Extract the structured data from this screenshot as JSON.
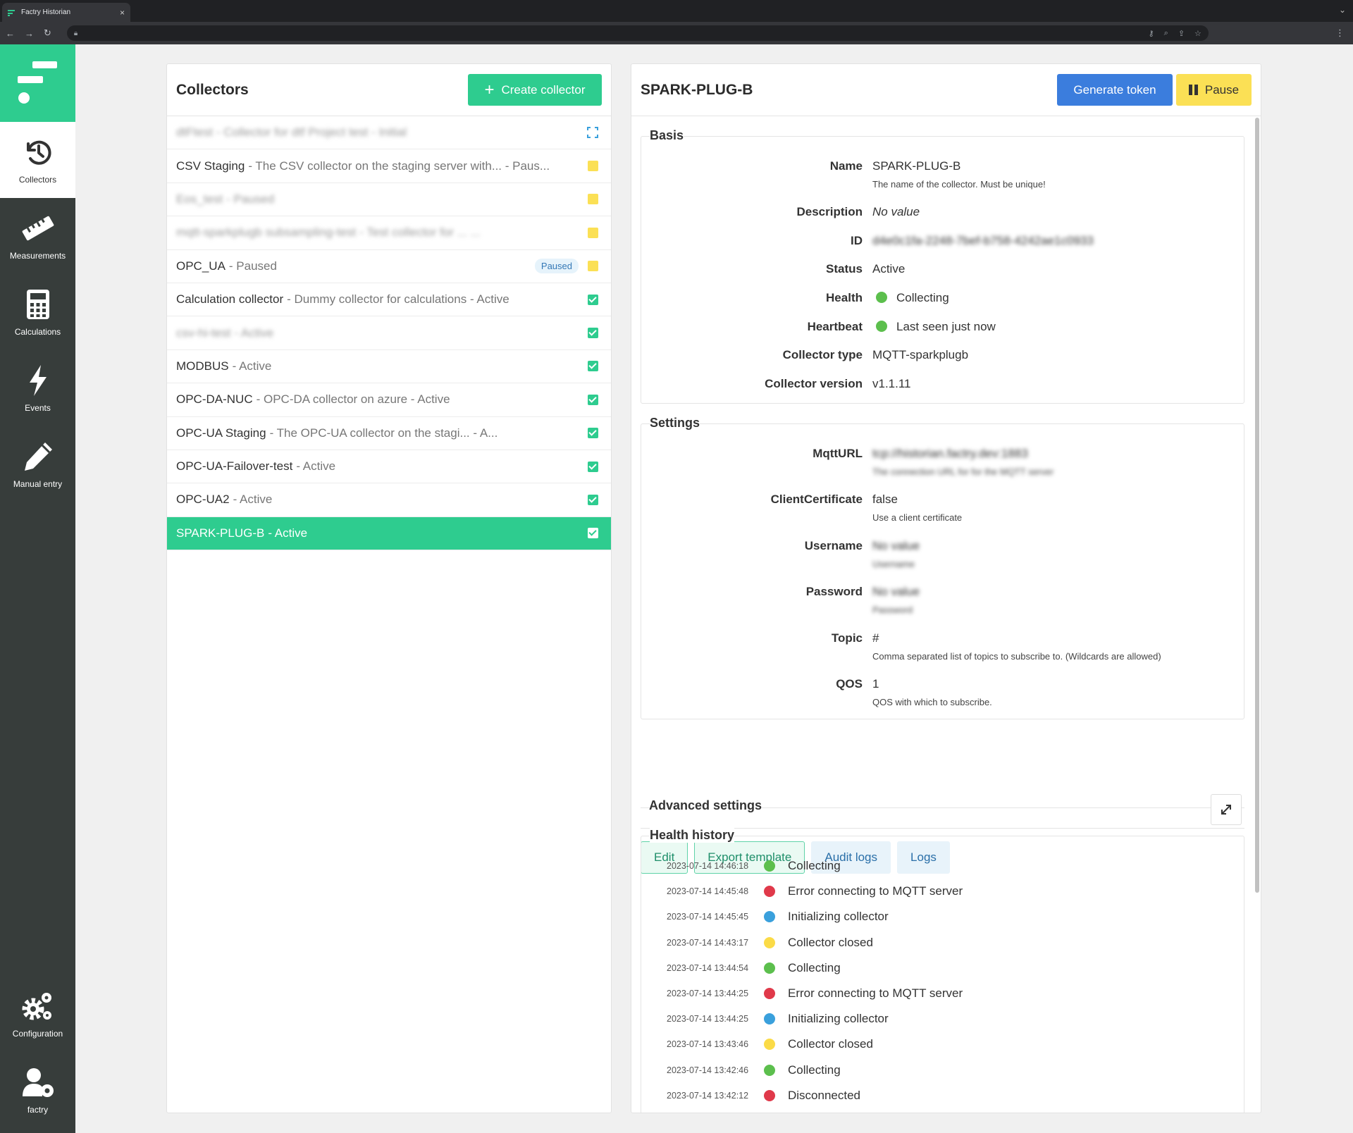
{
  "browser": {
    "tab_title": "Factry Historian",
    "tab_close": "×"
  },
  "sidebar": {
    "items": [
      {
        "label": "Collectors",
        "icon": "history-icon"
      },
      {
        "label": "Measurements",
        "icon": "ruler-icon"
      },
      {
        "label": "Calculations",
        "icon": "calculator-icon"
      },
      {
        "label": "Events",
        "icon": "bolt-icon"
      },
      {
        "label": "Manual entry",
        "icon": "pencil-icon"
      },
      {
        "label": "Configuration",
        "icon": "gears-icon"
      },
      {
        "label": "factry",
        "icon": "user-gear-icon"
      }
    ]
  },
  "collectors": {
    "title": "Collectors",
    "create_label": "Create collector",
    "items": [
      {
        "name": "dtFtest",
        "desc": "- Collector for dtf Project test - Initial",
        "blurred": true,
        "marker": "expand"
      },
      {
        "name": "CSV Staging",
        "desc": "- The CSV collector on the staging server with... - Paus...",
        "blurred": false,
        "marker": "yellow"
      },
      {
        "name": "Eos_test",
        "desc": "- Paused",
        "blurred": true,
        "marker": "yellow"
      },
      {
        "name": "mqtt-sparkplugb subsampling-test",
        "desc": "- Test collector for ... ...",
        "blurred": true,
        "marker": "yellow"
      },
      {
        "name": "OPC_UA",
        "desc": " - Paused",
        "blurred": false,
        "marker": "yellow",
        "badge": "Paused"
      },
      {
        "name": "Calculation collector",
        "desc": "- Dummy collector for calculations - Active",
        "blurred": false,
        "marker": "green"
      },
      {
        "name": "csv-hi-test",
        "desc": "- Active",
        "blurred": true,
        "marker": "green"
      },
      {
        "name": "MODBUS",
        "desc": " - Active",
        "blurred": false,
        "marker": "green"
      },
      {
        "name": "OPC-DA-NUC",
        "desc": "- OPC-DA collector on azure - Active",
        "blurred": false,
        "marker": "green"
      },
      {
        "name": "OPC-UA Staging",
        "desc": "- The OPC-UA collector on the stagi... - A...",
        "blurred": false,
        "marker": "green"
      },
      {
        "name": "OPC-UA-Failover-test",
        "desc": " - Active",
        "blurred": false,
        "marker": "green"
      },
      {
        "name": "OPC-UA2",
        "desc": " - Active",
        "blurred": false,
        "marker": "green"
      },
      {
        "name": "SPARK-PLUG-B",
        "desc": " - Active",
        "blurred": false,
        "marker": "white",
        "selected": true
      }
    ]
  },
  "detail": {
    "title": "SPARK-PLUG-B",
    "generate_token_label": "Generate token",
    "pause_label": "Pause",
    "basis": {
      "legend": "Basis",
      "name_key": "Name",
      "name_value": "SPARK-PLUG-B",
      "name_help": "The name of the collector. Must be unique!",
      "description_key": "Description",
      "description_value": "No value",
      "id_key": "ID",
      "id_value": "d4e0c1fa-2248-7bef-b758-4242ae1c0933",
      "status_key": "Status",
      "status_value": "Active",
      "health_key": "Health",
      "health_value": "Collecting",
      "heartbeat_key": "Heartbeat",
      "heartbeat_value": "Last seen just now",
      "type_key": "Collector type",
      "type_value": "MQTT-sparkplugb",
      "version_key": "Collector version",
      "version_value": "v1.1.11"
    },
    "settings": {
      "legend": "Settings",
      "mqtturl_key": "MqttURL",
      "mqtturl_value": "tcp://historian.factry.dev:1883",
      "mqtturl_help": "The connection URL for for the MQTT server",
      "clientcert_key": "ClientCertificate",
      "clientcert_value": "false",
      "clientcert_help": "Use a client certificate",
      "username_key": "Username",
      "username_value": "No value",
      "username_help": "Username",
      "password_key": "Password",
      "password_value": "No value",
      "password_help": "Password",
      "topic_key": "Topic",
      "topic_value": "#",
      "topic_help": "Comma separated list of topics to subscribe to. (Wildcards are allowed)",
      "qos_key": "QOS",
      "qos_value": "1",
      "qos_help": "QOS with which to subscribe."
    },
    "advanced_label": "Advanced settings",
    "actions": {
      "edit": "Edit",
      "export": "Export template",
      "audit": "Audit logs",
      "logs": "Logs"
    },
    "health_history": {
      "legend": "Health history",
      "entries": [
        {
          "time": "2023-07-14 14:46:18",
          "status": "green",
          "text": "Collecting"
        },
        {
          "time": "2023-07-14 14:45:48",
          "status": "red",
          "text": "Error connecting to MQTT server"
        },
        {
          "time": "2023-07-14 14:45:45",
          "status": "blue",
          "text": "Initializing collector"
        },
        {
          "time": "2023-07-14 14:43:17",
          "status": "yellow",
          "text": "Collector closed"
        },
        {
          "time": "2023-07-14 13:44:54",
          "status": "green",
          "text": "Collecting"
        },
        {
          "time": "2023-07-14 13:44:25",
          "status": "red",
          "text": "Error connecting to MQTT server"
        },
        {
          "time": "2023-07-14 13:44:25",
          "status": "blue",
          "text": "Initializing collector"
        },
        {
          "time": "2023-07-14 13:43:46",
          "status": "yellow",
          "text": "Collector closed"
        },
        {
          "time": "2023-07-14 13:42:46",
          "status": "green",
          "text": "Collecting"
        },
        {
          "time": "2023-07-14 13:42:12",
          "status": "red",
          "text": "Disconnected"
        }
      ]
    }
  },
  "colors": {
    "accent": "#2ecc8f",
    "sidebar": "#373d3b",
    "primary": "#3b7ddd",
    "warning": "#fbe055"
  }
}
